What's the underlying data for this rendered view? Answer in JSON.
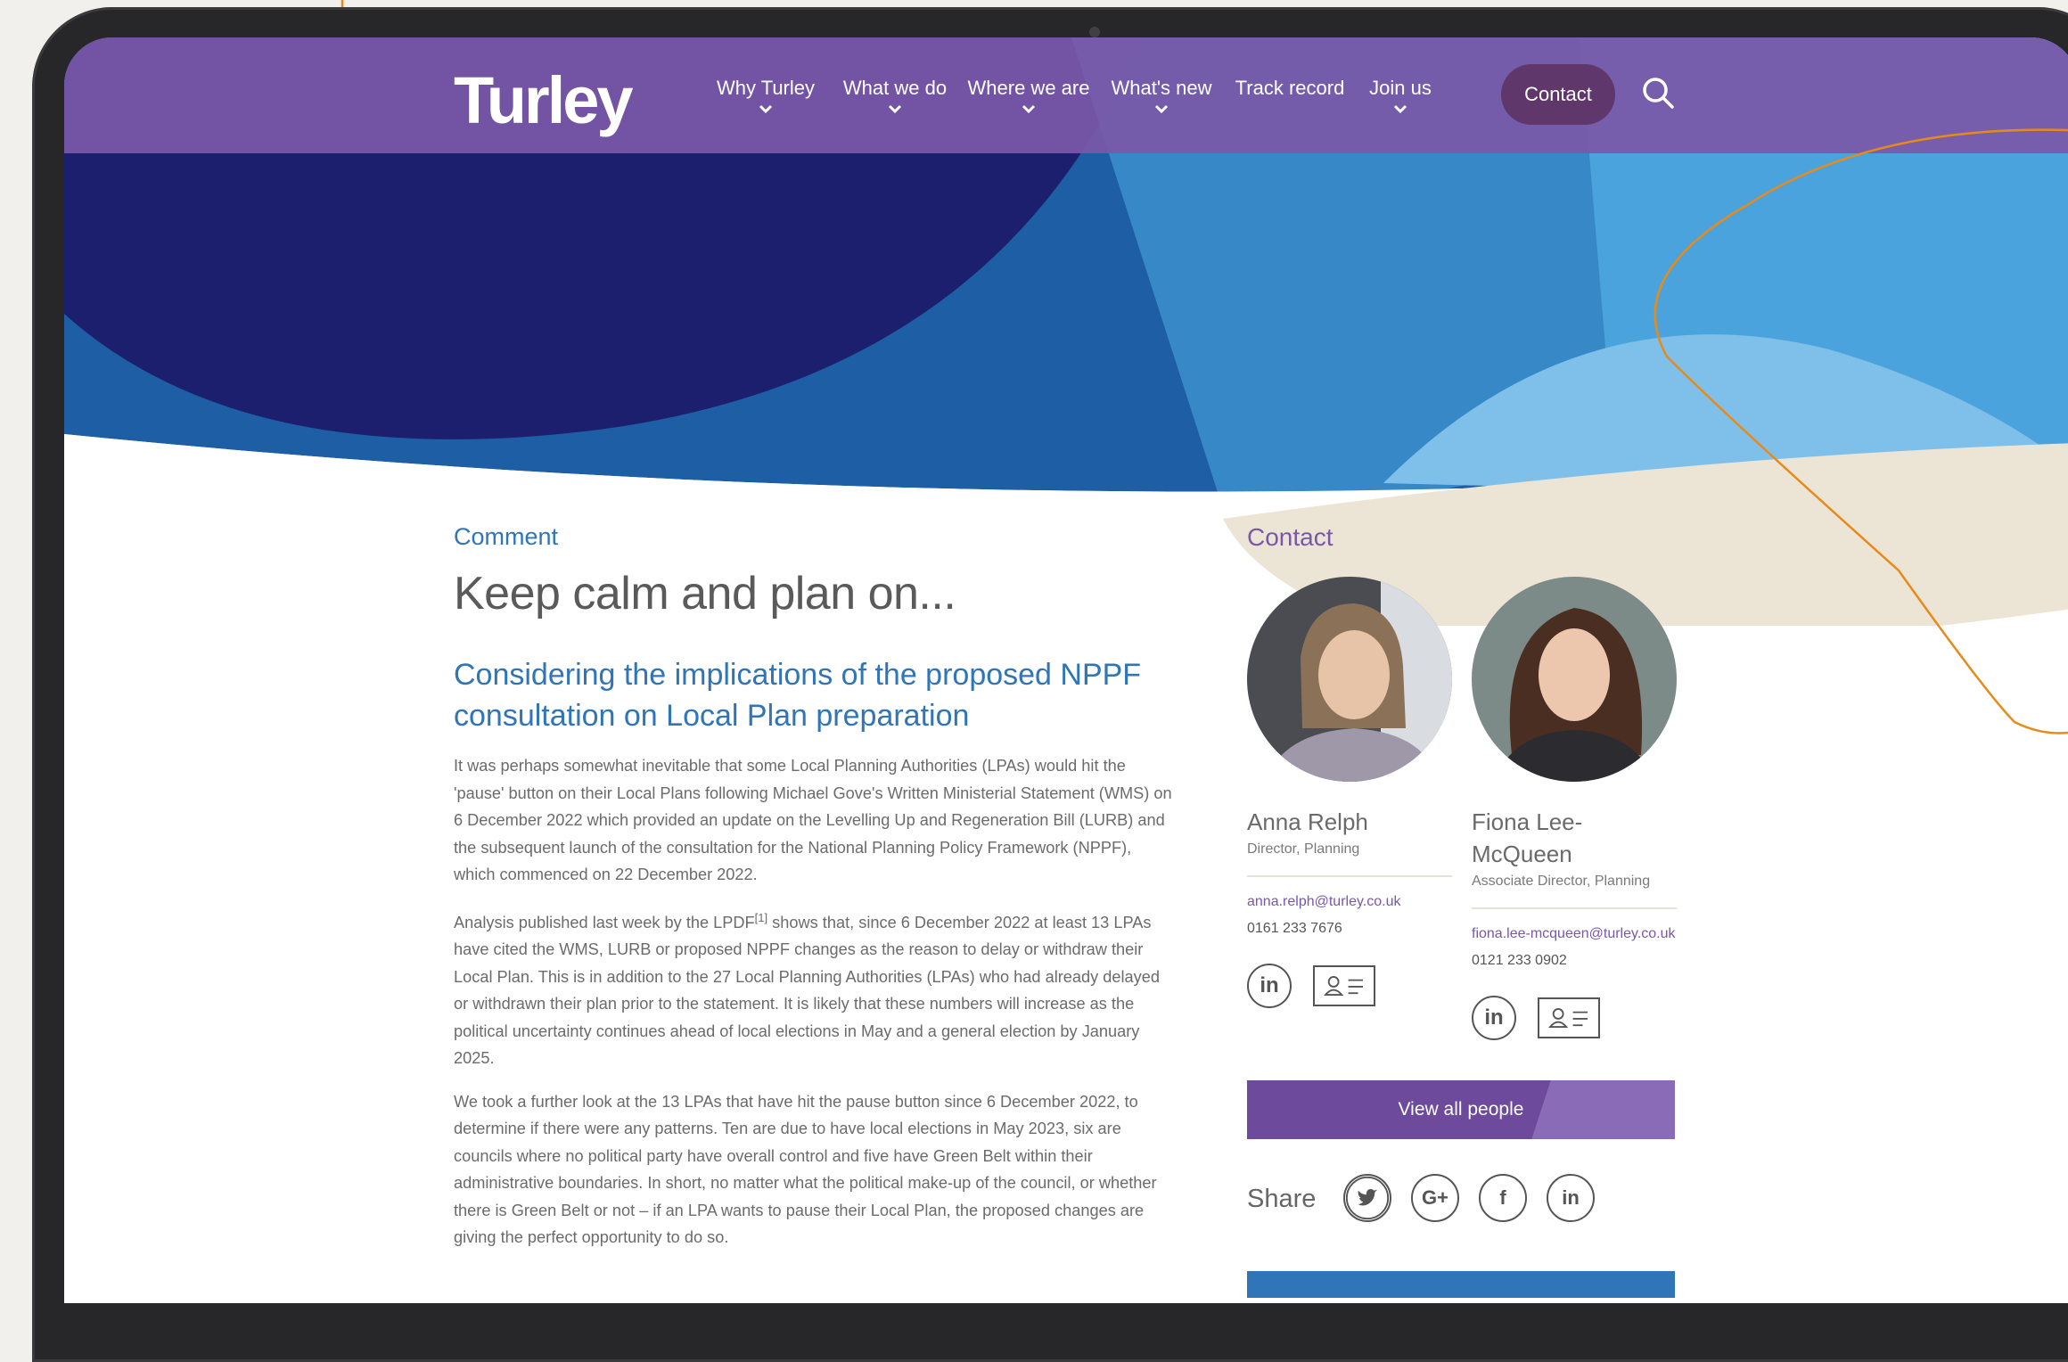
{
  "nav": {
    "logo": "Turley",
    "items": [
      {
        "label": "Why Turley",
        "has_dropdown": true
      },
      {
        "label": "What we do",
        "has_dropdown": true
      },
      {
        "label": "Where we are",
        "has_dropdown": true
      },
      {
        "label": "What's new",
        "has_dropdown": true
      },
      {
        "label": "Track record",
        "has_dropdown": false
      },
      {
        "label": "Join us",
        "has_dropdown": true
      }
    ],
    "contact": "Contact",
    "search_icon": "search-icon"
  },
  "article": {
    "eyebrow": "Comment",
    "title": "Keep calm and plan on...",
    "subtitle": "Considering the implications of the proposed NPPF consultation on Local Plan preparation",
    "p1": "It was perhaps somewhat inevitable that some Local Planning Authorities (LPAs) would hit the 'pause' button on their Local Plans following Michael Gove's Written Ministerial Statement (WMS) on 6 December 2022 which provided an update on the Levelling Up and Regeneration Bill (LURB) and the subsequent launch of the consultation for the National Planning Policy Framework (NPPF), which commenced on 22 December 2022.",
    "p2_before": "Analysis published last week by the LPDF",
    "p2_sup": "[1]",
    "p2_after": " shows that, since 6 December 2022 at least 13 LPAs have cited the WMS, LURB or proposed NPPF changes as the reason to delay or withdraw their Local Plan. This is in addition to the 27 Local Planning Authorities (LPAs) who had already delayed or withdrawn their plan prior to the statement. It is likely that these numbers will increase as the political uncertainty continues ahead of local elections in May and a general election by January 2025.",
    "p3": "We took a further look at the 13 LPAs that have hit the pause button since 6 December 2022, to determine if there were any patterns. Ten are due to have local elections in May 2023, six are councils where no political party have overall control and five have Green Belt within their administrative boundaries. In short, no matter what the political make-up of the council, or whether there is Green Belt or not – if an LPA wants to pause their Local Plan, the proposed changes are giving the perfect opportunity to do so."
  },
  "sidebar": {
    "title": "Contact",
    "people": [
      {
        "name": "Anna Relph",
        "role": "Director, Planning",
        "email": "anna.relph@turley.co.uk",
        "phone": "0161 233 7676"
      },
      {
        "name": "Fiona Lee-McQueen",
        "role": "Associate Director, Planning",
        "email": "fiona.lee-mcqueen@turley.co.uk",
        "phone": "0121 233 0902"
      }
    ],
    "view_all": "View all people",
    "share_label": "Share",
    "share_icons": [
      "twitter-icon",
      "google-plus-icon",
      "facebook-icon",
      "linkedin-icon"
    ]
  },
  "colors": {
    "nav_purple": "#7a58a8",
    "brand_blue": "#2f75b8",
    "hero_navy": "#1c1f6e",
    "button_purple": "#6d4a9c"
  }
}
